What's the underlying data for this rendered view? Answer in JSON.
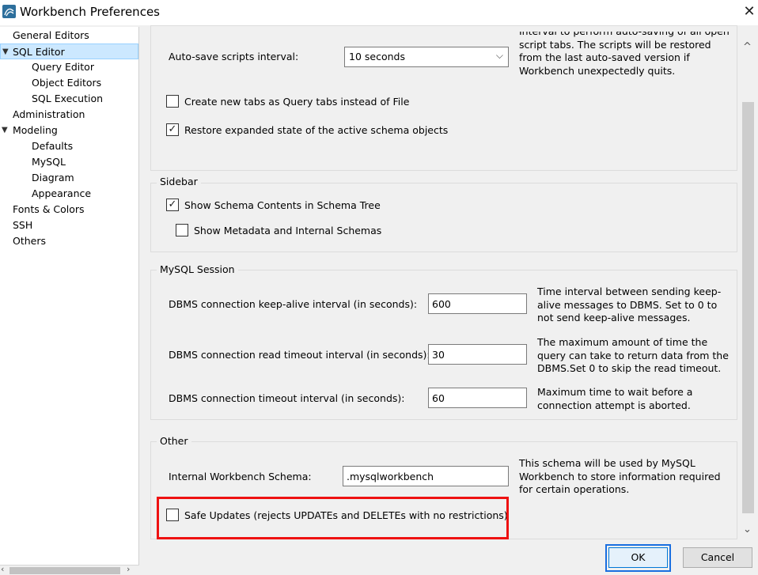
{
  "window": {
    "title": "Workbench Preferences"
  },
  "tree": {
    "items": [
      {
        "label": "General Editors"
      },
      {
        "label": "SQL Editor",
        "toggle": "▼"
      },
      {
        "label": "Query Editor"
      },
      {
        "label": "Object Editors"
      },
      {
        "label": "SQL Execution"
      },
      {
        "label": "Administration"
      },
      {
        "label": "Modeling",
        "toggle": "▼"
      },
      {
        "label": "Defaults"
      },
      {
        "label": "MySQL"
      },
      {
        "label": "Diagram"
      },
      {
        "label": "Appearance"
      },
      {
        "label": "Fonts & Colors"
      },
      {
        "label": "SSH"
      },
      {
        "label": "Others"
      }
    ]
  },
  "sql_editor": {
    "autosave_label": "Auto-save scripts interval:",
    "autosave_value": "10 seconds",
    "autosave_note": "Interval to perform auto-saving of all open script tabs. The scripts will be restored from the last auto-saved version if Workbench unexpectedly quits.",
    "new_tabs_label": "Create new tabs as Query tabs instead of File",
    "restore_state_label": "Restore expanded state of the active schema objects"
  },
  "sidebar": {
    "title": "Sidebar",
    "show_schema_contents": "Show Schema Contents in Schema Tree",
    "show_metadata": "Show Metadata and Internal Schemas"
  },
  "session": {
    "title": "MySQL Session",
    "keepalive_label": "DBMS connection keep-alive interval (in seconds):",
    "keepalive_value": "600",
    "keepalive_note": "Time interval between sending keep-alive messages to DBMS. Set to 0 to not send keep-alive messages.",
    "read_timeout_label": "DBMS connection read timeout interval (in seconds):",
    "read_timeout_value": "30",
    "read_timeout_note": "The maximum amount of time the query can take to return data from the DBMS.Set 0 to skip the read timeout.",
    "timeout_label": "DBMS connection timeout interval (in seconds):",
    "timeout_value": "60",
    "timeout_note": "Maximum time to wait before a connection attempt is aborted."
  },
  "other": {
    "title": "Other",
    "schema_label": "Internal Workbench Schema:",
    "schema_value": ".mysqlworkbench",
    "schema_note": "This schema will be used by MySQL Workbench to store information required for certain operations.",
    "safe_updates_label": "Safe Updates (rejects UPDATEs and DELETEs with no restrictions)"
  },
  "buttons": {
    "ok": "OK",
    "cancel": "Cancel"
  },
  "checks": {
    "new_tabs": false,
    "restore_state": true,
    "show_schema_contents": true,
    "show_metadata": false,
    "safe_updates": false
  },
  "colors": {
    "highlight_red": "#ee1111",
    "highlight_blue": "#1a6fe0",
    "selection": "#cce8ff"
  }
}
